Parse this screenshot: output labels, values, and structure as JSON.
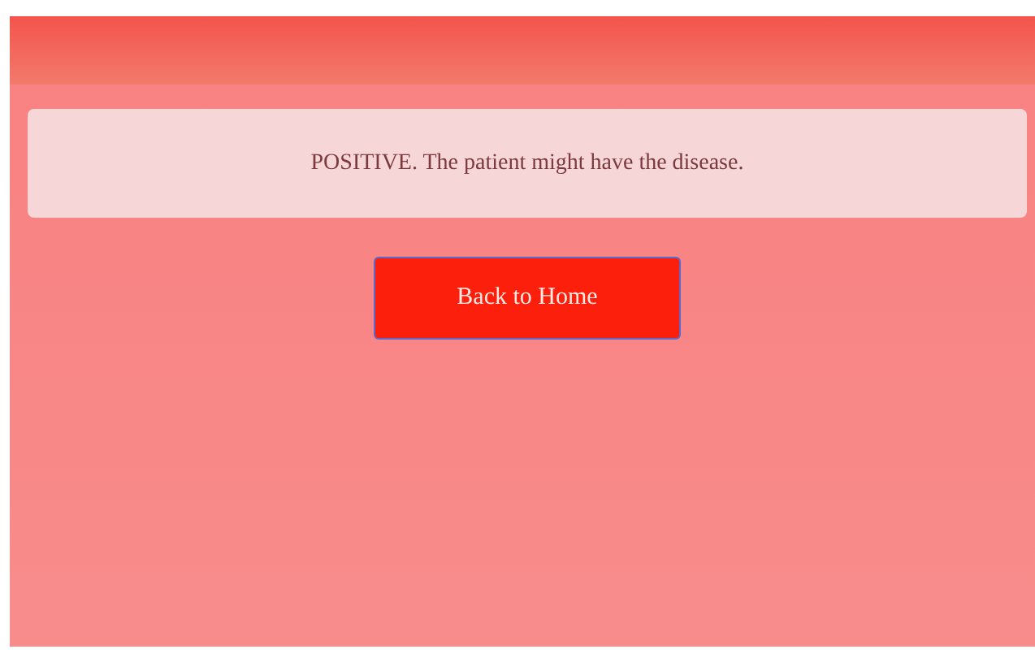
{
  "result": {
    "message": "POSITIVE. The patient might have the disease."
  },
  "back_button": {
    "label": "Back to Home"
  }
}
